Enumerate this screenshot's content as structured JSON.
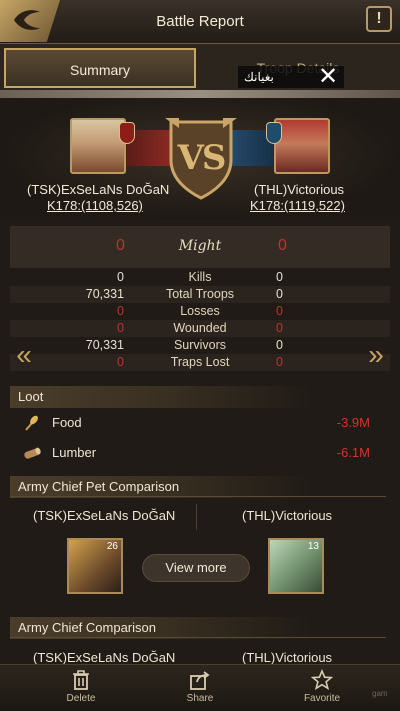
{
  "header": {
    "title": "Battle Report",
    "help_label": "!"
  },
  "tabs": [
    {
      "label": "Summary"
    },
    {
      "label": "Troop Details"
    }
  ],
  "toast": {
    "text": "بغيانك"
  },
  "battle": {
    "vs_label": "VS",
    "attacker": {
      "name": "(TSK)ExSeLaNs DoĞaN",
      "coords": "K178:(1108,526)"
    },
    "defender": {
      "name": "(THL)Victorious",
      "coords": "K178:(1119,522)"
    },
    "might": {
      "label": "Might",
      "left": "0",
      "right": "0"
    },
    "stats": [
      {
        "label": "Kills",
        "left": "0",
        "right": "0"
      },
      {
        "label": "Total Troops",
        "left": "70,331",
        "right": "0"
      },
      {
        "label": "Losses",
        "left": "0",
        "right": "0"
      },
      {
        "label": "Wounded",
        "left": "0",
        "right": "0"
      },
      {
        "label": "Survivors",
        "left": "70,331",
        "right": "0"
      },
      {
        "label": "Traps Lost",
        "left": "0",
        "right": "0"
      }
    ]
  },
  "loot": {
    "title": "Loot",
    "items": [
      {
        "name": "Food",
        "value": "-3.9M",
        "icon": "food-icon"
      },
      {
        "name": "Lumber",
        "value": "-6.1M",
        "icon": "lumber-icon"
      }
    ]
  },
  "pet_comparison": {
    "title": "Army Chief Pet Comparison",
    "left_name": "(TSK)ExSeLaNs DoĞaN",
    "right_name": "(THL)Victorious",
    "left_level": "26",
    "right_level": "13",
    "view_more_label": "View more"
  },
  "chief_comparison": {
    "title": "Army Chief Comparison",
    "left_name": "(TSK)ExSeLaNs DoĞaN",
    "right_name": "(THL)Victorious"
  },
  "footer": {
    "delete_label": "Delete",
    "share_label": "Share",
    "favorite_label": "Favorite"
  },
  "watermark": "gam"
}
